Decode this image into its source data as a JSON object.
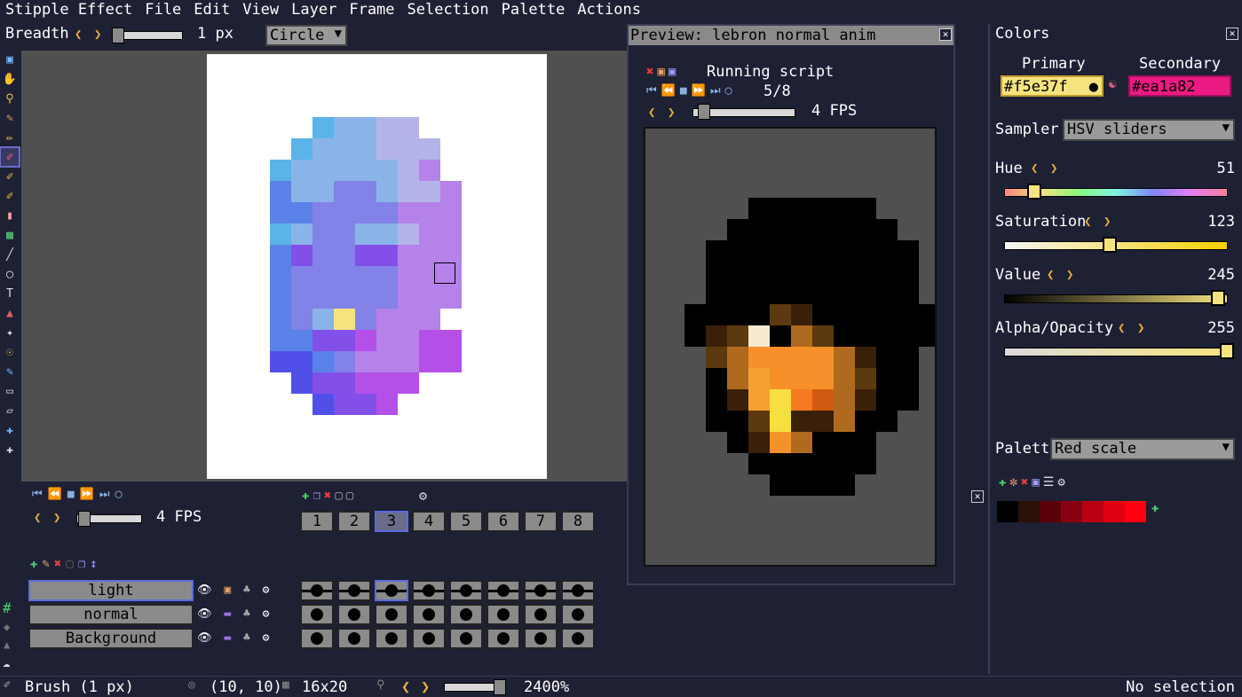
{
  "menu": {
    "app": "Stipple Effect",
    "items": [
      "File",
      "Edit",
      "View",
      "Layer",
      "Frame",
      "Selection",
      "Palette",
      "Actions"
    ]
  },
  "tool_options": {
    "breadth_label": "Breadth",
    "breadth_value": "1 px",
    "brush_shape": "Circle"
  },
  "tools": [
    "select-icon",
    "hand-icon",
    "zoom-icon",
    "eyedropper-icon",
    "pencil-icon",
    "brush-icon",
    "shade-brush-icon",
    "dither-brush-icon",
    "eraser-icon",
    "gradient-icon",
    "line-icon",
    "shape-icon",
    "text-icon",
    "fill-icon",
    "wand-icon",
    "pick-up-icon",
    "outline-icon",
    "box-select-icon",
    "poly-select-icon",
    "move-icon",
    "move-selection-icon"
  ],
  "animation": {
    "fps": "4 FPS",
    "frames": [
      "1",
      "2",
      "3",
      "4",
      "5",
      "6",
      "7",
      "8"
    ],
    "selected_frame": 3,
    "layers": [
      {
        "name": "light",
        "selected": true
      },
      {
        "name": "normal",
        "selected": false
      },
      {
        "name": "Background",
        "selected": false
      }
    ]
  },
  "preview": {
    "title": "Preview: lebron normal anim",
    "status": "Running script",
    "frame_counter": "5/8",
    "fps": "4 FPS"
  },
  "colors": {
    "panel_title": "Colors",
    "primary_label": "Primary",
    "secondary_label": "Secondary",
    "primary_hex": "#f5e37f",
    "secondary_hex": "#ea1a82",
    "sampler_label": "Sampler",
    "sampler_value": "HSV sliders",
    "hue_label": "Hue",
    "hue_value": "51",
    "saturation_label": "Saturation",
    "saturation_value": "123",
    "value_label": "Value",
    "value_value": "245",
    "alpha_label": "Alpha/Opacity",
    "alpha_value": "255",
    "palette_label": "Palette",
    "palette_value": "Red scale",
    "palette_swatches": [
      "#000000",
      "#2a1008",
      "#5c0008",
      "#880010",
      "#b80010",
      "#e00010",
      "#ff0010"
    ]
  },
  "status": {
    "tool": "Brush (1 px)",
    "cursor": "(10, 10)",
    "size": "16x20",
    "zoom": "2400%",
    "selection": "No selection"
  }
}
